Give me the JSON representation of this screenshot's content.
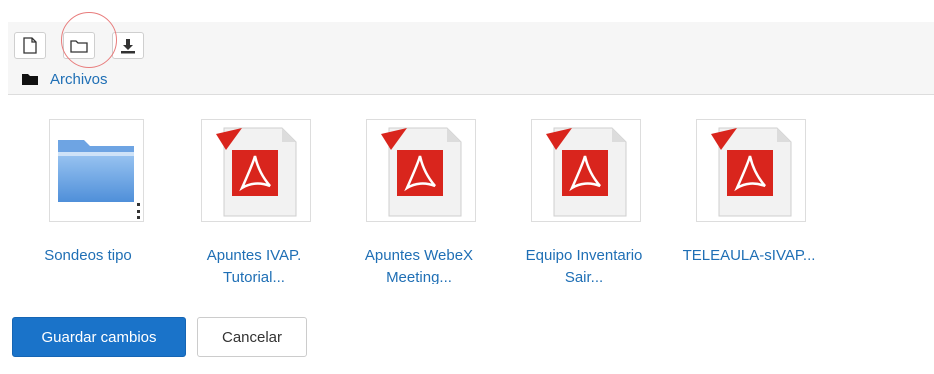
{
  "toolbar": {
    "buttons": [
      {
        "icon": "new-file-icon"
      },
      {
        "icon": "create-folder-icon"
      },
      {
        "icon": "download-icon"
      }
    ]
  },
  "breadcrumb": {
    "icon": "folder-solid-icon",
    "label": "Archivos"
  },
  "files": [
    {
      "name": "Sondeos tipo",
      "type": "folder",
      "icon": "folder-icon"
    },
    {
      "name": "Apuntes IVAP. Tutorial...",
      "type": "pdf",
      "icon": "pdf-icon"
    },
    {
      "name": "Apuntes WebeX Meeting...",
      "type": "pdf",
      "icon": "pdf-icon"
    },
    {
      "name": "Equipo Inventario Sair...",
      "type": "pdf",
      "icon": "pdf-icon"
    },
    {
      "name": "TELEAULA-sIVAP...",
      "type": "pdf",
      "icon": "pdf-icon"
    }
  ],
  "actions": {
    "save_label": "Guardar cambios",
    "cancel_label": "Cancelar"
  },
  "colors": {
    "primary": "#1a73c9",
    "link": "#1f6fb5",
    "pdf_red": "#d9251d",
    "highlight": "#e87c7c"
  }
}
